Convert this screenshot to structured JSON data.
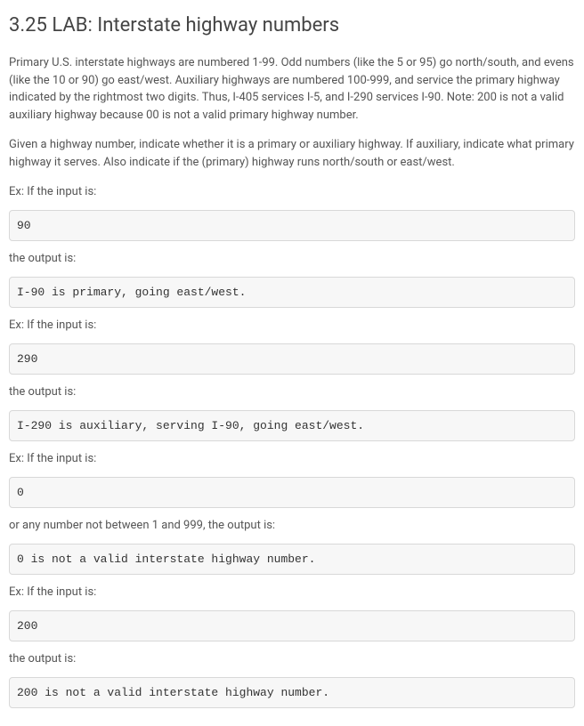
{
  "title": "3.25 LAB: Interstate highway numbers",
  "intro1": "Primary U.S. interstate highways are numbered 1-99. Odd numbers (like the 5 or 95) go north/south, and evens (like the 10 or 90) go east/west. Auxiliary highways are numbered 100-999, and service the primary highway indicated by the rightmost two digits. Thus, I-405 services I-5, and I-290 services I-90. Note: 200 is not a valid auxiliary highway because 00 is not a valid primary highway number.",
  "intro2": "Given a highway number, indicate whether it is a primary or auxiliary highway. If auxiliary, indicate what primary highway it serves. Also indicate if the (primary) highway runs north/south or east/west.",
  "ex_label_input": "Ex: If the input is:",
  "output_label": "the output is:",
  "or_label": "or any number not between 1 and 999, the output is:",
  "examples": [
    {
      "input": "90",
      "output": "I-90 is primary, going east/west."
    },
    {
      "input": "290",
      "output": "I-290 is auxiliary, serving I-90, going east/west."
    },
    {
      "input": "0",
      "output": "0 is not a valid interstate highway number."
    },
    {
      "input": "200",
      "output": "200 is not a valid interstate highway number."
    }
  ]
}
